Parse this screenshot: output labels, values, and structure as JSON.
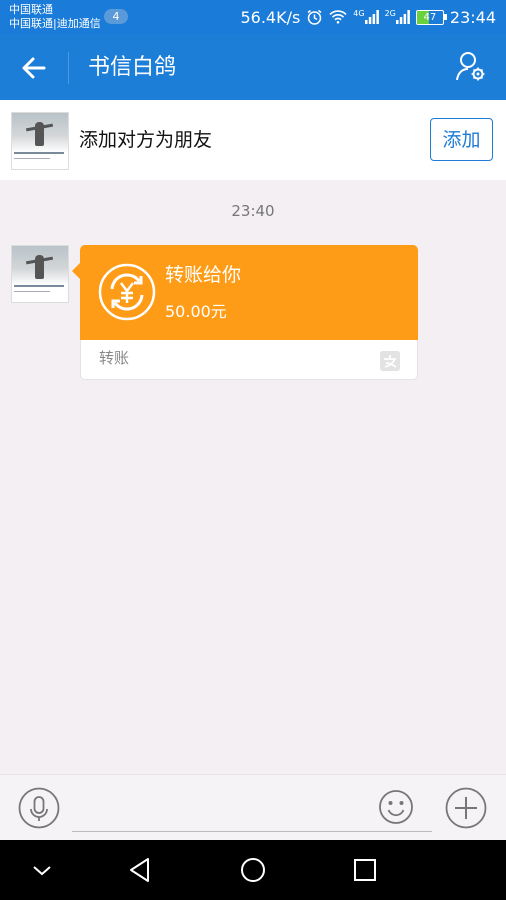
{
  "status_bar": {
    "carrier_1": "中国联通",
    "carrier_2": "中国联通|迪加通信",
    "notification_count": "4",
    "speed": "56.4K/s",
    "network_4g": "4G",
    "network_2g": "2G",
    "battery": "47",
    "time": "23:44"
  },
  "header": {
    "title": "书信白鸽",
    "back_icon": "back-arrow-icon",
    "profile_icon": "user-settings-icon"
  },
  "add_friend": {
    "text": "添加对方为朋友",
    "button": "添加"
  },
  "chat": {
    "timestamp": "23:40",
    "transfer": {
      "title": "转账给你",
      "amount": "50.00元",
      "label": "转账"
    }
  },
  "input": {
    "placeholder": ""
  },
  "colors": {
    "primary": "#1d7ed8",
    "transfer": "#ff9c17"
  }
}
